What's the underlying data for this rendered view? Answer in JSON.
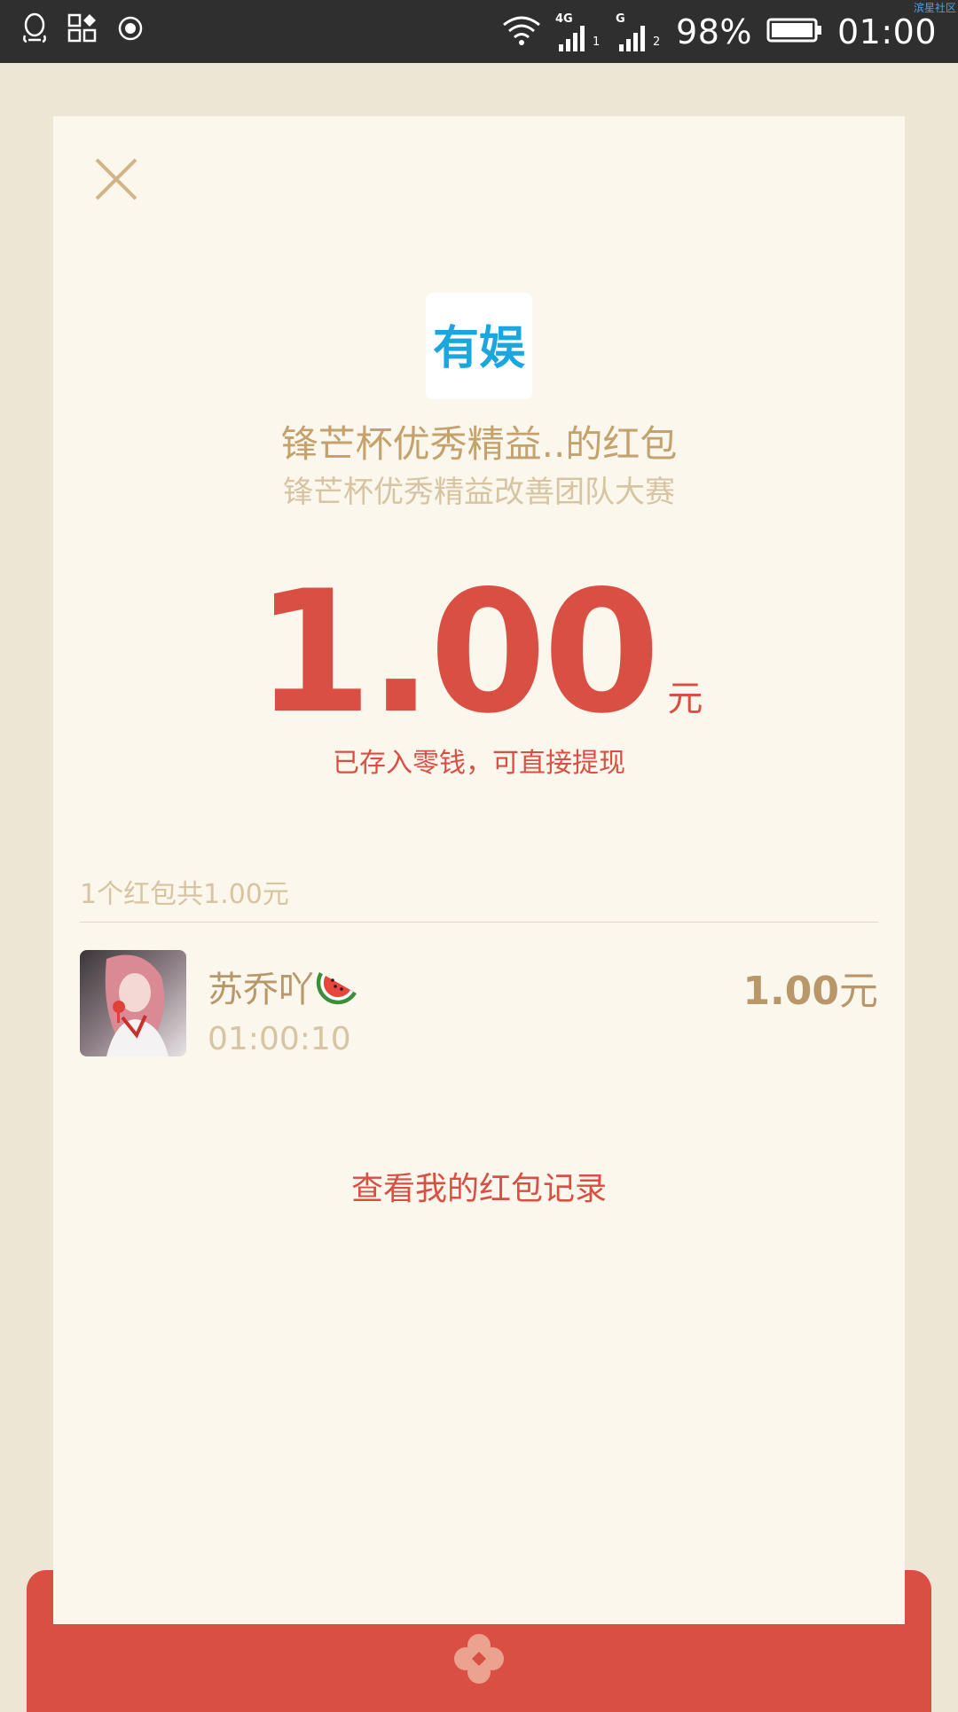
{
  "status_bar": {
    "battery_percent": "98%",
    "time": "01:00",
    "network_1": "4G",
    "network_2": "G",
    "sim_1": "1",
    "sim_2": "2",
    "corner_watermark": "滨星社区",
    "icons": [
      "qq-icon",
      "app-store-icon",
      "record-icon",
      "wifi-icon",
      "signal-icon",
      "battery-icon"
    ]
  },
  "packet": {
    "sender_logo_text": "有娱",
    "title": "锋芒杯优秀精益..的红包",
    "subtitle": "锋芒杯优秀精益改善团队大赛",
    "amount": "1.00",
    "unit": "元",
    "deposit_note": "已存入零钱，可直接提现"
  },
  "summary": "1个红包共1.00元",
  "recipients": [
    {
      "name": "苏乔吖",
      "emoji": "🍉",
      "time": "01:00:10",
      "amount": "1.00",
      "unit": "元"
    }
  ],
  "records_link": "查看我的红包记录",
  "colors": {
    "accent_red": "#D94F43",
    "gold": "#C4A26E",
    "card_bg": "#FBF7EC",
    "page_bg": "#EEE6D4"
  }
}
